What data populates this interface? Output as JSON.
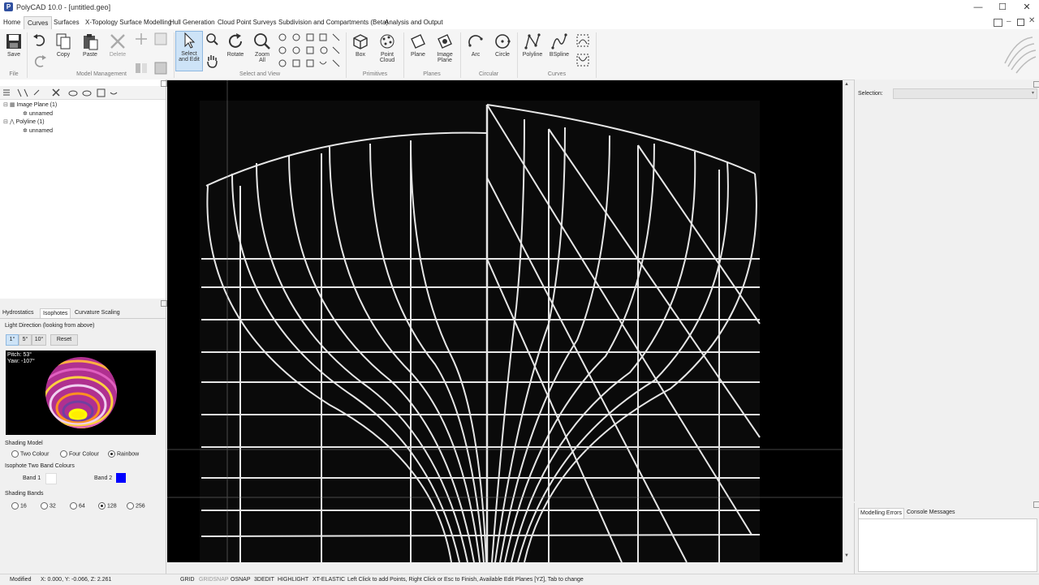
{
  "window": {
    "title": "PolyCAD 10.0 - [untitled.geo]",
    "controls": [
      "—",
      "☐",
      "✕"
    ]
  },
  "menu": [
    "Home",
    "Curves",
    "Surfaces",
    "X-Topology Surface Modelling",
    "Hull Generation",
    "Cloud Point Surveys",
    "Subdivision and Compartments (Beta)",
    "Analysis and Output"
  ],
  "ribbon": {
    "save": "Save",
    "copy": "Copy",
    "paste": "Paste",
    "delete": "Delete",
    "select_edit_1": "Select",
    "select_edit_2": "and Edit",
    "rotate": "Rotate",
    "zoom_all_1": "Zoom",
    "zoom_all_2": "All",
    "box": "Box",
    "point_cloud_1": "Point",
    "point_cloud_2": "Cloud",
    "plane": "Plane",
    "image_plane_1": "Image",
    "image_plane_2": "Plane",
    "arc": "Arc",
    "circle": "Circle",
    "polyline": "Polyline",
    "bspline": "BSpline",
    "groups": {
      "file": "File",
      "model_management": "Model Management",
      "select_view": "Select and View",
      "primitives": "Primitives",
      "planes": "Planes",
      "circular": "Circular",
      "curves": "Curves"
    }
  },
  "tree": {
    "image_plane": "Image Plane (1)",
    "image_plane_child": "unnamed",
    "polyline": "Polyline (1)",
    "polyline_child": "unnamed"
  },
  "panel_tabs": [
    "Hydrostatics",
    "Isophotes",
    "Curvature Scaling"
  ],
  "isophotes": {
    "light_direction": "Light Direction (looking from above)",
    "step_buttons": [
      "1°",
      "5°",
      "10°"
    ],
    "reset": "Reset",
    "pitch": "Pitch: 53°",
    "yaw": "Yaw: -107°",
    "shading_model_label": "Shading Model",
    "shading_models": [
      "Two Colour",
      "Four Colour",
      "Rainbow"
    ],
    "selected_model": "Rainbow",
    "band_colours_label": "Isophote Two Band Colours",
    "band1": "Band 1",
    "band2": "Band 2",
    "band1_color": "#ffffff",
    "band2_color": "#0000ff",
    "shading_bands_label": "Shading Bands",
    "shading_bands": [
      "16",
      "32",
      "64",
      "128",
      "256"
    ],
    "selected_bands": "128"
  },
  "right": {
    "selection_label": "Selection:",
    "tabs": [
      "Modelling Errors",
      "Console Messages"
    ]
  },
  "status": {
    "modified": "Modified",
    "coords": "X:  0.000, Y:  -0.066, Z:  2.261",
    "toggles": [
      "GRID",
      "GRIDSNAP",
      "OSNAP",
      "3DEDIT",
      "HIGHLIGHT",
      "XT-ELASTIC"
    ],
    "message": "Left Click to add Points, Right Click or Esc to Finish, Available Edit Planes [YZ], Tab to change"
  }
}
